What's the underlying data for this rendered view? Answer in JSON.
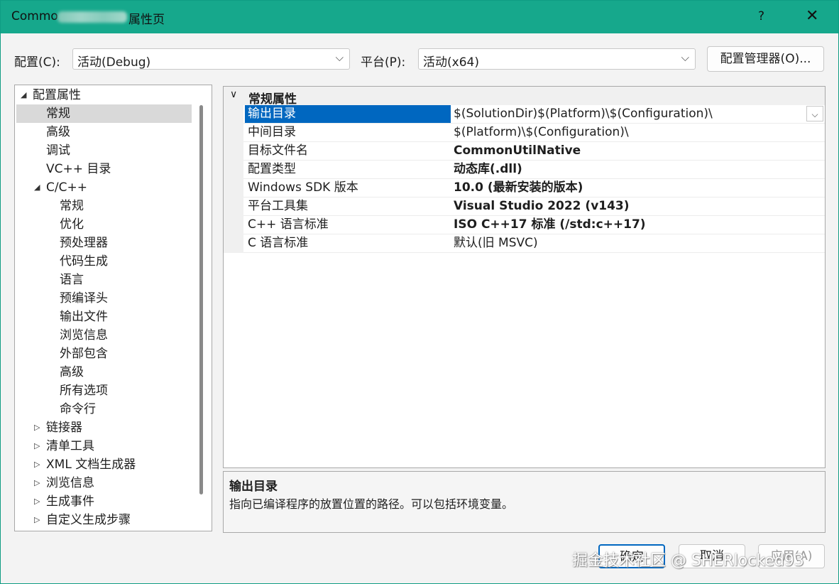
{
  "window": {
    "title_prefix": "Commo",
    "title_suffix": "属性页",
    "help": "?",
    "close": "✕"
  },
  "toolbar": {
    "config_label": "配置(C):",
    "config_value": "活动(Debug)",
    "platform_label": "平台(P):",
    "platform_value": "活动(x64)",
    "config_manager": "配置管理器(O)..."
  },
  "tree": {
    "items": [
      {
        "label": "配置属性",
        "arrow": "◢"
      },
      {
        "label": "常规"
      },
      {
        "label": "高级"
      },
      {
        "label": "调试"
      },
      {
        "label": "VC++ 目录"
      },
      {
        "label": "C/C++",
        "arrow": "◢"
      },
      {
        "label": "常规"
      },
      {
        "label": "优化"
      },
      {
        "label": "预处理器"
      },
      {
        "label": "代码生成"
      },
      {
        "label": "语言"
      },
      {
        "label": "预编译头"
      },
      {
        "label": "输出文件"
      },
      {
        "label": "浏览信息"
      },
      {
        "label": "外部包含"
      },
      {
        "label": "高级"
      },
      {
        "label": "所有选项"
      },
      {
        "label": "命令行"
      },
      {
        "label": "链接器",
        "arrow": "▷"
      },
      {
        "label": "清单工具",
        "arrow": "▷"
      },
      {
        "label": "XML 文档生成器",
        "arrow": "▷"
      },
      {
        "label": "浏览信息",
        "arrow": "▷"
      },
      {
        "label": "生成事件",
        "arrow": "▷"
      },
      {
        "label": "自定义生成步骤",
        "arrow": "▷"
      }
    ]
  },
  "grid": {
    "category": "常规属性",
    "rows": [
      {
        "name": "输出目录",
        "value": "$(SolutionDir)$(Platform)\\$(Configuration)\\"
      },
      {
        "name": "中间目录",
        "value": "$(Platform)\\$(Configuration)\\"
      },
      {
        "name": "目标文件名",
        "value": "CommonUtilNative"
      },
      {
        "name": "配置类型",
        "value": "动态库(.dll)"
      },
      {
        "name": "Windows SDK 版本",
        "value": "10.0 (最新安装的版本)"
      },
      {
        "name": "平台工具集",
        "value": "Visual Studio 2022 (v143)"
      },
      {
        "name": "C++ 语言标准",
        "value": "ISO C++17 标准 (/std:c++17)"
      },
      {
        "name": "C 语言标准",
        "value": "默认(旧 MSVC)"
      }
    ]
  },
  "description": {
    "title": "输出目录",
    "text": "指向已编译程序的放置位置的路径。可以包括环境变量。"
  },
  "footer": {
    "ok": "确定",
    "cancel": "取消",
    "apply": "应用(A)"
  },
  "watermark": "掘金技术社区 @ SHERlocked93"
}
